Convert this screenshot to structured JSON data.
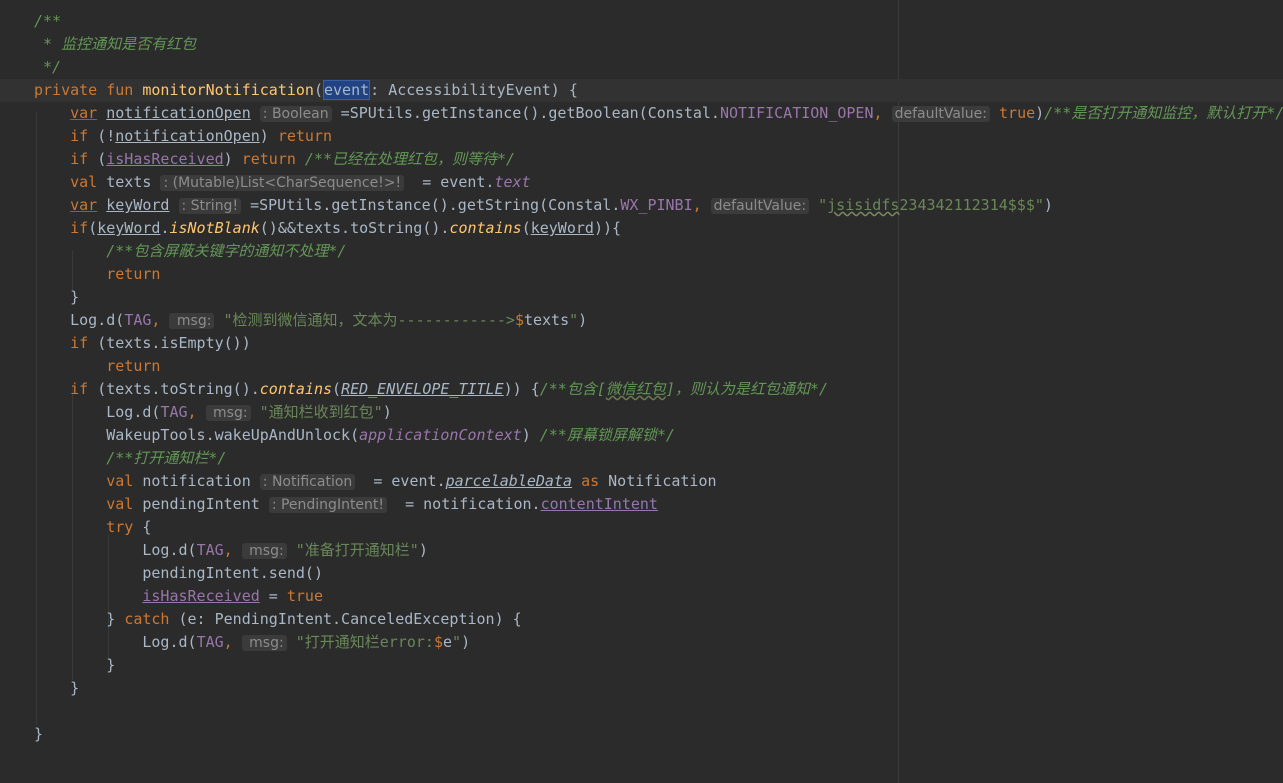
{
  "editor": {
    "language": "Kotlin",
    "colors": {
      "background": "#2b2b2b",
      "keyword": "#cc7832",
      "function": "#ffc66d",
      "comment": "#629755",
      "string": "#6a8759",
      "property": "#9876aa",
      "text": "#a9b7c6",
      "hint": "#8c8c8c"
    },
    "gutter_icon": "lightbulb-icon",
    "lines": [
      {
        "indent": 0,
        "tokens": [
          {
            "t": "/**",
            "c": "comment"
          }
        ]
      },
      {
        "indent": 0,
        "tokens": [
          {
            "t": " * 监控通知是否有红包",
            "c": "comment"
          }
        ]
      },
      {
        "indent": 0,
        "tokens": [
          {
            "t": " */",
            "c": "comment"
          }
        ]
      },
      {
        "indent": 0,
        "caret": true,
        "tokens": [
          {
            "t": "private fun ",
            "c": "keyword"
          },
          {
            "t": "monitorNotification",
            "c": "fn"
          },
          {
            "t": "(",
            "c": "plain"
          },
          {
            "t": "event",
            "c": "highlight"
          },
          {
            "t": ": AccessibilityEvent) {",
            "c": "plain"
          }
        ]
      },
      {
        "indent": 1,
        "tokens": [
          {
            "t": "var",
            "c": "kwvar"
          },
          {
            "t": " ",
            "c": "plain"
          },
          {
            "t": "notificationOpen",
            "c": "mutvar"
          },
          {
            "t": " ",
            "c": "plain"
          },
          {
            "t": ": Boolean",
            "c": "hint"
          },
          {
            "t": " =SPUtils.getInstance().getBoolean(Constal.",
            "c": "plain"
          },
          {
            "t": "NOTIFICATION_OPEN",
            "c": "const"
          },
          {
            "t": ", ",
            "c": "keyword"
          },
          {
            "t": "defaultValue:",
            "c": "hint"
          },
          {
            "t": " ",
            "c": "plain"
          },
          {
            "t": "true",
            "c": "keyword"
          },
          {
            "t": ")",
            "c": "plain"
          },
          {
            "t": "/**是否打开通知监控，默认打开*/",
            "c": "comment"
          }
        ]
      },
      {
        "indent": 1,
        "tokens": [
          {
            "t": "if",
            "c": "keyword"
          },
          {
            "t": " (!",
            "c": "plain"
          },
          {
            "t": "notificationOpen",
            "c": "mutvar"
          },
          {
            "t": ") ",
            "c": "plain"
          },
          {
            "t": "return",
            "c": "keyword"
          }
        ]
      },
      {
        "indent": 1,
        "tokens": [
          {
            "t": "if",
            "c": "keyword"
          },
          {
            "t": " (",
            "c": "plain"
          },
          {
            "t": "isHasReceived",
            "c": "mutprop"
          },
          {
            "t": ") ",
            "c": "plain"
          },
          {
            "t": "return",
            "c": "keyword"
          },
          {
            "t": " /**已经在处理红包，则等待*/",
            "c": "comment"
          }
        ]
      },
      {
        "indent": 1,
        "tokens": [
          {
            "t": "val",
            "c": "keyword"
          },
          {
            "t": " texts ",
            "c": "plain"
          },
          {
            "t": ": (Mutable)List<CharSequence!>!",
            "c": "hint"
          },
          {
            "t": "  = ",
            "c": "plain"
          },
          {
            "t": "event",
            "c": "plain"
          },
          {
            "t": ".",
            "c": "plain"
          },
          {
            "t": "text",
            "c": "propitalic"
          }
        ]
      },
      {
        "indent": 1,
        "tokens": [
          {
            "t": "var",
            "c": "kwvar"
          },
          {
            "t": " ",
            "c": "plain"
          },
          {
            "t": "keyWord",
            "c": "mutvar"
          },
          {
            "t": " ",
            "c": "plain"
          },
          {
            "t": ": String!",
            "c": "hint"
          },
          {
            "t": " =SPUtils.getInstance().getString(Constal.",
            "c": "plain"
          },
          {
            "t": "WX_PINBI",
            "c": "const"
          },
          {
            "t": ", ",
            "c": "keyword"
          },
          {
            "t": "defaultValue:",
            "c": "hint"
          },
          {
            "t": " \"",
            "c": "string"
          },
          {
            "t": "jsisidfs",
            "c": "stringtypo"
          },
          {
            "t": "234342112314$$$\"",
            "c": "string"
          },
          {
            "t": ")",
            "c": "plain"
          }
        ]
      },
      {
        "indent": 1,
        "tokens": [
          {
            "t": "if",
            "c": "keyword"
          },
          {
            "t": "(",
            "c": "plain"
          },
          {
            "t": "keyWord",
            "c": "mutvar"
          },
          {
            "t": ".",
            "c": "plain"
          },
          {
            "t": "isNotBlank",
            "c": "ext"
          },
          {
            "t": "()&&texts.toString().",
            "c": "plain"
          },
          {
            "t": "contains",
            "c": "ext"
          },
          {
            "t": "(",
            "c": "plain"
          },
          {
            "t": "keyWord",
            "c": "mutvar"
          },
          {
            "t": ")){",
            "c": "plain"
          }
        ]
      },
      {
        "indent": 2,
        "tokens": [
          {
            "t": "/**包含屏蔽关键字的通知不处理*/",
            "c": "comment"
          }
        ]
      },
      {
        "indent": 2,
        "tokens": [
          {
            "t": "return",
            "c": "keyword"
          }
        ]
      },
      {
        "indent": 1,
        "tokens": [
          {
            "t": "}",
            "c": "plain"
          }
        ]
      },
      {
        "indent": 1,
        "tokens": [
          {
            "t": "Log.d(",
            "c": "plain"
          },
          {
            "t": "TAG",
            "c": "const"
          },
          {
            "t": ", ",
            "c": "keyword"
          },
          {
            "t": " msg:",
            "c": "hint"
          },
          {
            "t": " \"检测到微信通知，文本为------------>",
            "c": "string"
          },
          {
            "t": "$",
            "c": "keyword"
          },
          {
            "t": "texts",
            "c": "plain"
          },
          {
            "t": "\"",
            "c": "string"
          },
          {
            "t": ")",
            "c": "plain"
          }
        ]
      },
      {
        "indent": 1,
        "tokens": [
          {
            "t": "if",
            "c": "keyword"
          },
          {
            "t": " (texts.isEmpty())",
            "c": "plain"
          }
        ]
      },
      {
        "indent": 2,
        "tokens": [
          {
            "t": "return",
            "c": "keyword"
          }
        ]
      },
      {
        "indent": 1,
        "tokens": [
          {
            "t": "if",
            "c": "keyword"
          },
          {
            "t": " (texts.toString().",
            "c": "plain"
          },
          {
            "t": "contains",
            "c": "ext"
          },
          {
            "t": "(",
            "c": "plain"
          },
          {
            "t": "RED_ENVELOPE_TITLE",
            "c": "constul"
          },
          {
            "t": ")) {",
            "c": "plain"
          },
          {
            "t": "/**包含[",
            "c": "comment"
          },
          {
            "t": "微信红包",
            "c": "commentref"
          },
          {
            "t": "]，则认为是红包通知*/",
            "c": "comment"
          }
        ]
      },
      {
        "indent": 2,
        "tokens": [
          {
            "t": "Log.d(",
            "c": "plain"
          },
          {
            "t": "TAG",
            "c": "const"
          },
          {
            "t": ", ",
            "c": "keyword"
          },
          {
            "t": " msg:",
            "c": "hint"
          },
          {
            "t": " \"通知栏收到红包\"",
            "c": "string"
          },
          {
            "t": ")",
            "c": "plain"
          }
        ]
      },
      {
        "indent": 2,
        "tokens": [
          {
            "t": "WakeupTools.wakeUpAndUnlock(",
            "c": "plain"
          },
          {
            "t": "applicationContext",
            "c": "propitalic"
          },
          {
            "t": ") ",
            "c": "plain"
          },
          {
            "t": "/**屏幕锁屏解锁*/",
            "c": "comment"
          }
        ]
      },
      {
        "indent": 2,
        "tokens": [
          {
            "t": "/**打开通知栏*/",
            "c": "comment"
          }
        ]
      },
      {
        "indent": 2,
        "tokens": [
          {
            "t": "val",
            "c": "keyword"
          },
          {
            "t": " notification ",
            "c": "plain"
          },
          {
            "t": ": Notification",
            "c": "hint"
          },
          {
            "t": "  = ",
            "c": "plain"
          },
          {
            "t": "event",
            "c": "plain"
          },
          {
            "t": ".",
            "c": "plain"
          },
          {
            "t": "parcelableData",
            "c": "propitalicul"
          },
          {
            "t": " ",
            "c": "plain"
          },
          {
            "t": "as",
            "c": "keyword"
          },
          {
            "t": " Notification",
            "c": "plain"
          }
        ]
      },
      {
        "indent": 2,
        "tokens": [
          {
            "t": "val",
            "c": "keyword"
          },
          {
            "t": " pendingIntent ",
            "c": "plain"
          },
          {
            "t": ": PendingIntent!",
            "c": "hint"
          },
          {
            "t": "  = notification.",
            "c": "plain"
          },
          {
            "t": "contentIntent",
            "c": "mutprop"
          }
        ]
      },
      {
        "indent": 2,
        "tokens": [
          {
            "t": "try",
            "c": "keyword"
          },
          {
            "t": " {",
            "c": "plain"
          }
        ]
      },
      {
        "indent": 3,
        "tokens": [
          {
            "t": "Log.d(",
            "c": "plain"
          },
          {
            "t": "TAG",
            "c": "const"
          },
          {
            "t": ", ",
            "c": "keyword"
          },
          {
            "t": " msg:",
            "c": "hint"
          },
          {
            "t": " \"准备打开通知栏\"",
            "c": "string"
          },
          {
            "t": ")",
            "c": "plain"
          }
        ]
      },
      {
        "indent": 3,
        "tokens": [
          {
            "t": "pendingIntent.send()",
            "c": "plain"
          }
        ]
      },
      {
        "indent": 3,
        "tokens": [
          {
            "t": "isHasReceived",
            "c": "mutprop"
          },
          {
            "t": " = ",
            "c": "plain"
          },
          {
            "t": "true",
            "c": "keyword"
          }
        ]
      },
      {
        "indent": 2,
        "tokens": [
          {
            "t": "} ",
            "c": "plain"
          },
          {
            "t": "catch",
            "c": "keyword"
          },
          {
            "t": " (e: PendingIntent.CanceledException) {",
            "c": "plain"
          }
        ]
      },
      {
        "indent": 3,
        "tokens": [
          {
            "t": "Log.d(",
            "c": "plain"
          },
          {
            "t": "TAG",
            "c": "const"
          },
          {
            "t": ", ",
            "c": "keyword"
          },
          {
            "t": " msg:",
            "c": "hint"
          },
          {
            "t": " \"打开通知栏error:",
            "c": "string"
          },
          {
            "t": "$",
            "c": "keyword"
          },
          {
            "t": "e",
            "c": "plain"
          },
          {
            "t": "\"",
            "c": "string"
          },
          {
            "t": ")",
            "c": "plain"
          }
        ]
      },
      {
        "indent": 2,
        "tokens": [
          {
            "t": "}",
            "c": "plain"
          }
        ]
      },
      {
        "indent": 1,
        "tokens": [
          {
            "t": "}",
            "c": "plain"
          }
        ]
      },
      {
        "indent": 0,
        "tokens": [
          {
            "t": "",
            "c": "plain"
          }
        ]
      },
      {
        "indent": 0,
        "tokens": [
          {
            "t": "}",
            "c": "plain"
          }
        ]
      }
    ]
  }
}
